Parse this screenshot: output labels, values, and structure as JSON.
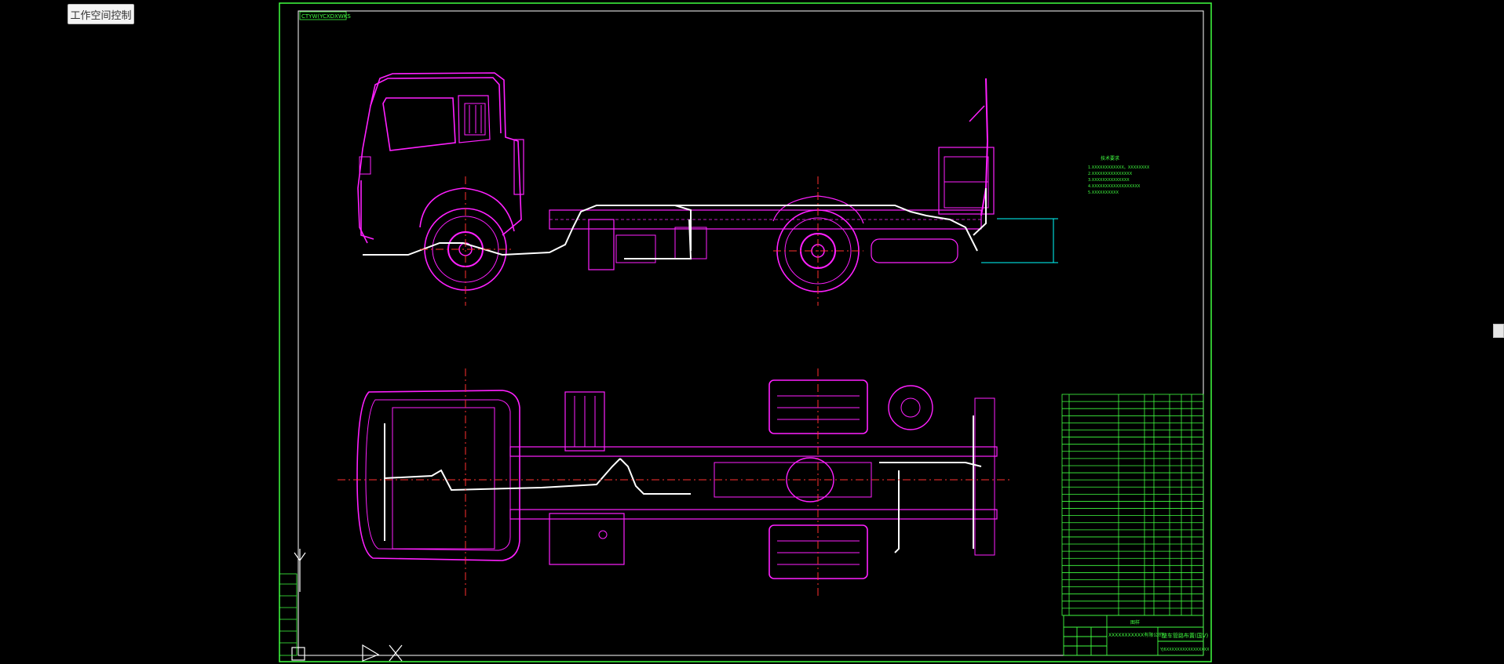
{
  "toolbar": {
    "workspace_button_label": "工作空间控制"
  },
  "drawing": {
    "frame_tag": "CTYW(YCXDXWKS",
    "tech_notes_heading": "技术要求",
    "tech_notes": [
      "1.XXXXXXXXXXXX。XXXXXXXX",
      "2.XXXXXXXXXXXXXXX",
      "3.XXXXXXXXXXXXXX",
      "4.XXXXXXXXXXXXXXXXXX",
      "5.XXXXXXXXXX"
    ],
    "title_block": {
      "title": "整车管路布置(国V)",
      "drawing_no": "YJ6XXXXXXXXXXXXXXXX",
      "company": "XXXXXXXXXXX有限公司",
      "mark": "图样"
    },
    "colors": {
      "vehicle": "#ff20ff",
      "frame": "#40ff40",
      "pipe": "#ffffff",
      "center": "#ff3030",
      "dim": "#00ffff"
    }
  }
}
